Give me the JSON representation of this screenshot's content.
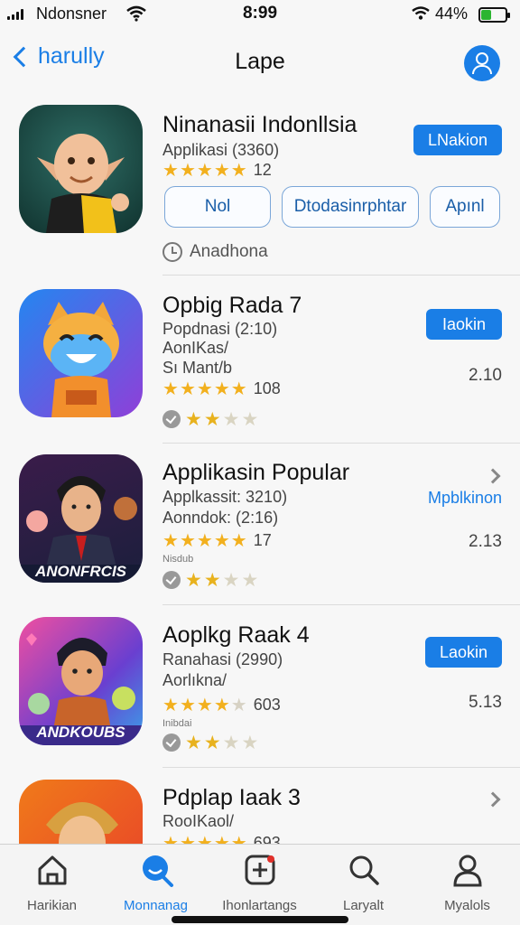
{
  "status_bar": {
    "carrier": "Ndonsner",
    "time": "8:99",
    "battery_pct": "44%",
    "battery_level": 0.44,
    "icons": [
      "signal-icon",
      "wifi-icon",
      "location-icon",
      "battery-icon"
    ]
  },
  "nav": {
    "back_label": "harully",
    "title": "Lape",
    "profile_icon": "person-icon"
  },
  "colors": {
    "accent": "#1a7ee6",
    "star": "#f2b01e"
  },
  "apps": [
    {
      "name": "Ninanasii Indonllsia",
      "sub1": "Applikasi (3360)",
      "rating_count": "12",
      "action": "LNakion",
      "chips": [
        "Nol",
        "Dtodasinrphtar",
        "Apınl"
      ],
      "footer": "Anadhona"
    },
    {
      "name": "Opbig Rada 7",
      "sub1": "Popdnasi (2:10)",
      "sub2": "AonIKas/",
      "sub3": "Sı Mant/b",
      "rating_count": "108",
      "action": "Iaokin",
      "side_value": "2.10",
      "mini_rating": 2.5
    },
    {
      "name": "Applikasin Popular",
      "sub1": "Applkassit: 3210)",
      "sub2": "Aonndok: (2:16)",
      "rating_count": "17",
      "action": "Mpblkinon",
      "side_value": "2.13",
      "tiny": "Nisdub",
      "mini_rating": 2.5,
      "icon_caption": "ANONFRCIS"
    },
    {
      "name": "Aoplkg Raak 4",
      "sub1": "Ranahasi (2990)",
      "sub2": "Aorlıkna/",
      "rating_count": "603",
      "action": "Laokin",
      "side_value": "5.13",
      "tiny": "Inibdai",
      "mini_rating": 2.5,
      "icon_caption": "ANDKOUBS"
    },
    {
      "name": "Pdplap Iaak 3",
      "sub1": "RooIKaol/",
      "rating_count": "693"
    }
  ],
  "tabs": [
    {
      "label": "Harikian",
      "icon": "home-icon"
    },
    {
      "label": "Monnanag",
      "icon": "chat-search-icon",
      "active": true
    },
    {
      "label": "Ihonlartangs",
      "icon": "add-square-icon"
    },
    {
      "label": "Laryalt",
      "icon": "search-icon"
    },
    {
      "label": "Myalols",
      "icon": "person-icon"
    }
  ]
}
